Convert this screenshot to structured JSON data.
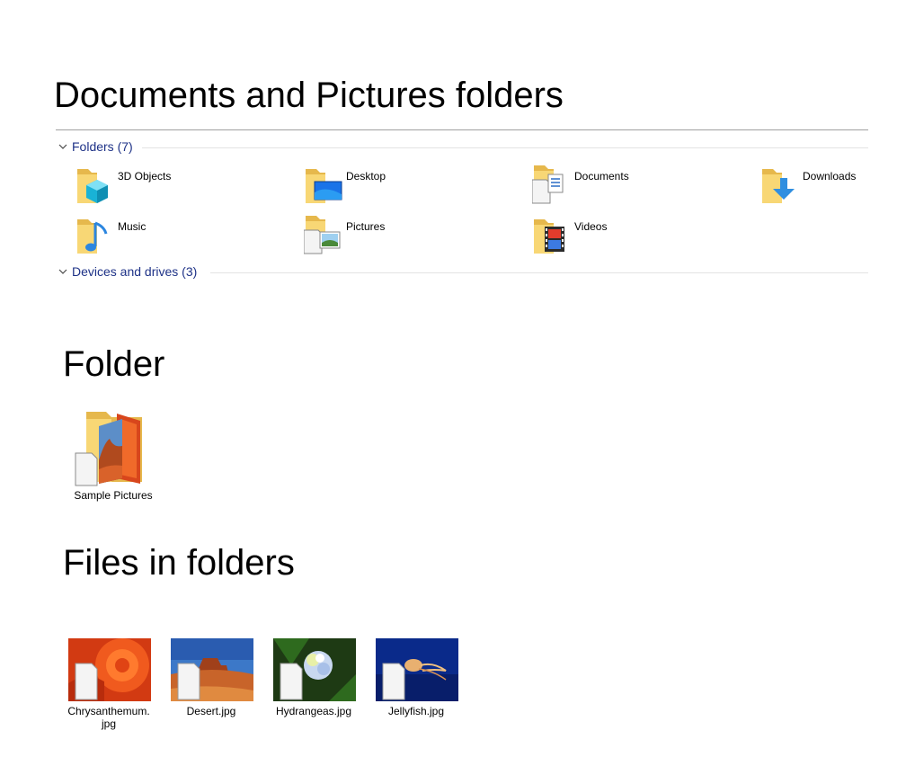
{
  "sections": {
    "known_folders_title": "Documents and Pictures folders",
    "folder_title": "Folder",
    "files_title": "Files in folders"
  },
  "explorer": {
    "folders_group": "Folders (7)",
    "devices_group": "Devices and drives (3)",
    "folders": [
      {
        "label": "3D Objects",
        "icon": "3d-objects-folder-icon"
      },
      {
        "label": "Desktop",
        "icon": "desktop-folder-icon"
      },
      {
        "label": "Documents",
        "icon": "documents-folder-icon"
      },
      {
        "label": "Downloads",
        "icon": "downloads-folder-icon"
      },
      {
        "label": "Music",
        "icon": "music-folder-icon"
      },
      {
        "label": "Pictures",
        "icon": "pictures-folder-icon"
      },
      {
        "label": "Videos",
        "icon": "videos-folder-icon"
      }
    ]
  },
  "folder_item": {
    "label": "Sample Pictures"
  },
  "files": [
    {
      "label": "Chrysanthemum.\njpg",
      "icon": "chrysanthemum-thumbnail"
    },
    {
      "label": "Desert.jpg",
      "icon": "desert-thumbnail"
    },
    {
      "label": "Hydrangeas.jpg",
      "icon": "hydrangeas-thumbnail"
    },
    {
      "label": "Jellyfish.jpg",
      "icon": "jellyfish-thumbnail"
    }
  ],
  "colors": {
    "group_header": "#1e3287",
    "folder_yellow": "#f8d775",
    "folder_dark": "#e6b84c"
  }
}
